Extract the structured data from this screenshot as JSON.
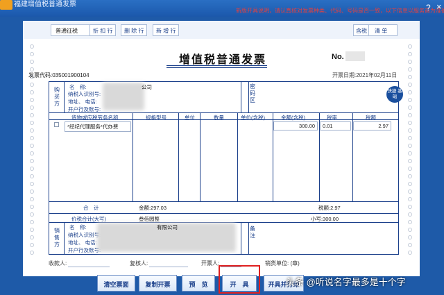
{
  "window": {
    "title": "福建增值税普通发票",
    "notice": "新版开具说明，请认真核对发票种类、代码、号码是否一致，以下信息以服务商为准确发票",
    "help": "?",
    "close": "×"
  },
  "toolbar": {
    "tax_type": "普通征税",
    "discount": "折 扣 行",
    "delete": "删 除 行",
    "add": "新 增 行",
    "tax_incl": "含税",
    "tax_incl_state": "开",
    "clear": "清 单"
  },
  "invoice": {
    "title": "增值税普通发票",
    "no_label": "No.",
    "code": "发票代码:035001900104",
    "date": "开票日期:2021年02月11日"
  },
  "buyer": {
    "side": "购买方",
    "name": "名　称:",
    "taxid": "纳税人识别号:",
    "addr": "地址、 电话:",
    "bank": "开户行及账号:",
    "company_suffix": "公司",
    "pwd_label": "密码区"
  },
  "quick": {
    "label": "快捷 基础"
  },
  "items": {
    "headers": [
      "货物或应税劳务名称",
      "规格型号",
      "单位",
      "数量",
      "单价(含税)",
      "金额(含税)",
      "税率",
      "税额"
    ],
    "row": {
      "name": "*经纪代理服务*代办费",
      "amount": "300.00",
      "rate": "0.01",
      "tax": "2.97"
    }
  },
  "totals": {
    "total_label": "合　计",
    "amount": "金额:297.03",
    "tax": "税额:2.97",
    "price_tax_label": "价税合计(大写)",
    "price_tax_words": "叁佰圆整",
    "small": "小写:300.00"
  },
  "seller": {
    "side": "销售方",
    "name": "名　称:",
    "taxid": "纳税人识别号:",
    "addr": "地址、 电话:",
    "bank": "开户行及账号:",
    "company_suffix": "有限公司",
    "remark": "备注"
  },
  "bottom": {
    "payee": "收款人:",
    "reviewer": "复核人:",
    "issuer": "开票人:",
    "seller_unit": "销货单位: (章)"
  },
  "buttons": {
    "clear_ticket": "清空票面",
    "copy": "复制开票",
    "preview": "预　览",
    "issue": "开　具",
    "issue_print": "开具并打印"
  },
  "watermark": "头条 @听说名字最多是十个字"
}
